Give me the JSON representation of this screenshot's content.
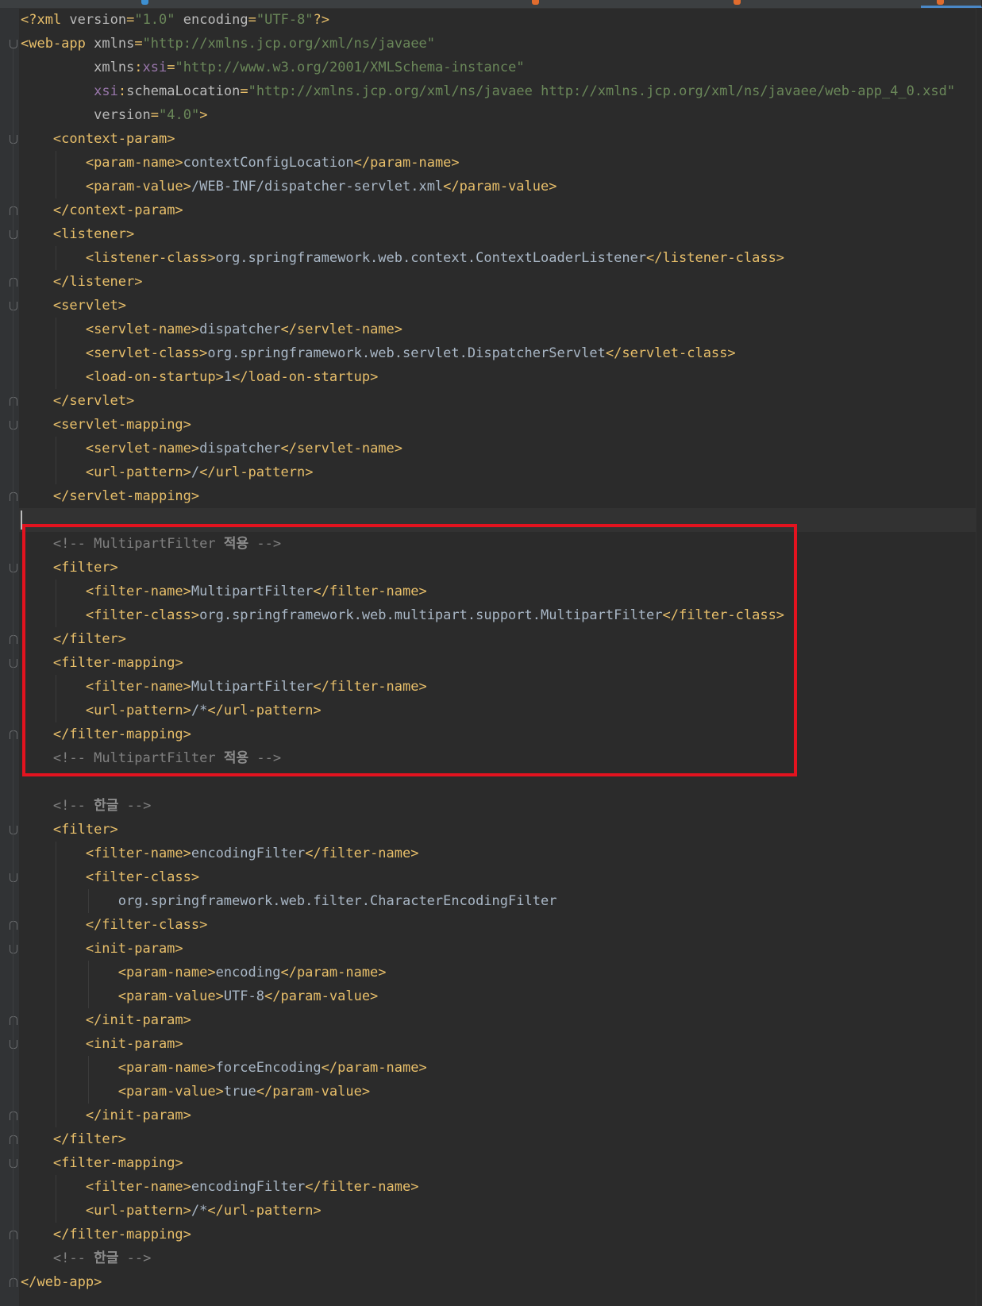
{
  "editor": {
    "language": "xml",
    "colors": {
      "background": "#2b2b2b",
      "tag": "#e8bf6a",
      "attribute": "#bababa",
      "value": "#6a8759",
      "namespace": "#9876aa",
      "text": "#a9b7c6",
      "comment": "#808080",
      "highlight_box": "#e3131f"
    },
    "lines": [
      {
        "indent": 0,
        "tokens": [
          [
            "tg",
            "<?xml "
          ],
          [
            "at",
            "version"
          ],
          [
            "tg",
            "="
          ],
          [
            "vl",
            "\"1.0\""
          ],
          [
            "at",
            " encoding"
          ],
          [
            "tg",
            "="
          ],
          [
            "vl",
            "\"UTF-8\""
          ],
          [
            "tg",
            "?>"
          ]
        ]
      },
      {
        "indent": 0,
        "tokens": [
          [
            "tg",
            "<web-app "
          ],
          [
            "at",
            "xmlns"
          ],
          [
            "tg",
            "="
          ],
          [
            "vl",
            "\"http://xmlns.jcp.org/xml/ns/javaee\""
          ]
        ]
      },
      {
        "indent": 0,
        "tokens": [
          [
            "at",
            "         xmlns"
          ],
          [
            "tg",
            ":"
          ],
          [
            "ns",
            "xsi"
          ],
          [
            "tg",
            "="
          ],
          [
            "vl",
            "\"http://www.w3.org/2001/XMLSchema-instance\""
          ]
        ]
      },
      {
        "indent": 0,
        "tokens": [
          [
            "ns",
            "         xsi"
          ],
          [
            "tg",
            ":"
          ],
          [
            "at",
            "schemaLocation"
          ],
          [
            "tg",
            "="
          ],
          [
            "vl",
            "\"http://xmlns.jcp.org/xml/ns/javaee http://xmlns.jcp.org/xml/ns/javaee/web-app_4_0.xsd\""
          ]
        ]
      },
      {
        "indent": 0,
        "tokens": [
          [
            "at",
            "         version"
          ],
          [
            "tg",
            "="
          ],
          [
            "vl",
            "\"4.0\""
          ],
          [
            "tg",
            ">"
          ]
        ]
      },
      {
        "indent": 1,
        "tokens": [
          [
            "tg",
            "<context-param>"
          ]
        ]
      },
      {
        "indent": 2,
        "tokens": [
          [
            "tg",
            "<param-name>"
          ],
          [
            "tx",
            "contextConfigLocation"
          ],
          [
            "tg",
            "</param-name>"
          ]
        ]
      },
      {
        "indent": 2,
        "tokens": [
          [
            "tg",
            "<param-value>"
          ],
          [
            "tx",
            "/WEB-INF/dispatcher-servlet.xml"
          ],
          [
            "tg",
            "</param-value>"
          ]
        ]
      },
      {
        "indent": 1,
        "tokens": [
          [
            "tg",
            "</context-param>"
          ]
        ]
      },
      {
        "indent": 1,
        "tokens": [
          [
            "tg",
            "<listener>"
          ]
        ]
      },
      {
        "indent": 2,
        "tokens": [
          [
            "tg",
            "<listener-class>"
          ],
          [
            "tx",
            "org.springframework.web.context.ContextLoaderListener"
          ],
          [
            "tg",
            "</listener-class>"
          ]
        ]
      },
      {
        "indent": 1,
        "tokens": [
          [
            "tg",
            "</listener>"
          ]
        ]
      },
      {
        "indent": 1,
        "tokens": [
          [
            "tg",
            "<servlet>"
          ]
        ]
      },
      {
        "indent": 2,
        "tokens": [
          [
            "tg",
            "<servlet-name>"
          ],
          [
            "tx",
            "dispatcher"
          ],
          [
            "tg",
            "</servlet-name>"
          ]
        ]
      },
      {
        "indent": 2,
        "tokens": [
          [
            "tg",
            "<servlet-class>"
          ],
          [
            "tx",
            "org.springframework.web.servlet.DispatcherServlet"
          ],
          [
            "tg",
            "</servlet-class>"
          ]
        ]
      },
      {
        "indent": 2,
        "tokens": [
          [
            "tg",
            "<load-on-startup>"
          ],
          [
            "tx",
            "1"
          ],
          [
            "tg",
            "</load-on-startup>"
          ]
        ]
      },
      {
        "indent": 1,
        "tokens": [
          [
            "tg",
            "</servlet>"
          ]
        ]
      },
      {
        "indent": 1,
        "tokens": [
          [
            "tg",
            "<servlet-mapping>"
          ]
        ]
      },
      {
        "indent": 2,
        "tokens": [
          [
            "tg",
            "<servlet-name>"
          ],
          [
            "tx",
            "dispatcher"
          ],
          [
            "tg",
            "</servlet-name>"
          ]
        ]
      },
      {
        "indent": 2,
        "tokens": [
          [
            "tg",
            "<url-pattern>"
          ],
          [
            "tx",
            "/"
          ],
          [
            "tg",
            "</url-pattern>"
          ]
        ]
      },
      {
        "indent": 1,
        "tokens": [
          [
            "tg",
            "</servlet-mapping>"
          ]
        ]
      },
      {
        "indent": 0,
        "tokens": []
      },
      {
        "indent": 1,
        "tokens": [
          [
            "cm",
            "<!-- MultipartFilter "
          ],
          [
            "kr",
            "적용"
          ],
          [
            "cm",
            " -->"
          ]
        ]
      },
      {
        "indent": 1,
        "tokens": [
          [
            "tg",
            "<filter>"
          ]
        ]
      },
      {
        "indent": 2,
        "tokens": [
          [
            "tg",
            "<filter-name>"
          ],
          [
            "tx",
            "MultipartFilter"
          ],
          [
            "tg",
            "</filter-name>"
          ]
        ]
      },
      {
        "indent": 2,
        "tokens": [
          [
            "tg",
            "<filter-class>"
          ],
          [
            "tx",
            "org.springframework.web.multipart.support.MultipartFilter"
          ],
          [
            "tg",
            "</filter-class>"
          ]
        ]
      },
      {
        "indent": 1,
        "tokens": [
          [
            "tg",
            "</filter>"
          ]
        ]
      },
      {
        "indent": 1,
        "tokens": [
          [
            "tg",
            "<filter-mapping>"
          ]
        ]
      },
      {
        "indent": 2,
        "tokens": [
          [
            "tg",
            "<filter-name>"
          ],
          [
            "tx",
            "MultipartFilter"
          ],
          [
            "tg",
            "</filter-name>"
          ]
        ]
      },
      {
        "indent": 2,
        "tokens": [
          [
            "tg",
            "<url-pattern>"
          ],
          [
            "tx",
            "/*"
          ],
          [
            "tg",
            "</url-pattern>"
          ]
        ]
      },
      {
        "indent": 1,
        "tokens": [
          [
            "tg",
            "</filter-mapping>"
          ]
        ]
      },
      {
        "indent": 1,
        "tokens": [
          [
            "cm",
            "<!-- MultipartFilter "
          ],
          [
            "kr",
            "적용"
          ],
          [
            "cm",
            " -->"
          ]
        ]
      },
      {
        "indent": 0,
        "tokens": []
      },
      {
        "indent": 1,
        "tokens": [
          [
            "cm",
            "<!-- "
          ],
          [
            "kr",
            "한글"
          ],
          [
            "cm",
            " -->"
          ]
        ]
      },
      {
        "indent": 1,
        "tokens": [
          [
            "tg",
            "<filter>"
          ]
        ]
      },
      {
        "indent": 2,
        "tokens": [
          [
            "tg",
            "<filter-name>"
          ],
          [
            "tx",
            "encodingFilter"
          ],
          [
            "tg",
            "</filter-name>"
          ]
        ]
      },
      {
        "indent": 2,
        "tokens": [
          [
            "tg",
            "<filter-class>"
          ]
        ]
      },
      {
        "indent": 3,
        "tokens": [
          [
            "tx",
            "org.springframework.web.filter.CharacterEncodingFilter"
          ]
        ]
      },
      {
        "indent": 2,
        "tokens": [
          [
            "tg",
            "</filter-class>"
          ]
        ]
      },
      {
        "indent": 2,
        "tokens": [
          [
            "tg",
            "<init-param>"
          ]
        ]
      },
      {
        "indent": 3,
        "tokens": [
          [
            "tg",
            "<param-name>"
          ],
          [
            "tx",
            "encoding"
          ],
          [
            "tg",
            "</param-name>"
          ]
        ]
      },
      {
        "indent": 3,
        "tokens": [
          [
            "tg",
            "<param-value>"
          ],
          [
            "tx",
            "UTF-8"
          ],
          [
            "tg",
            "</param-value>"
          ]
        ]
      },
      {
        "indent": 2,
        "tokens": [
          [
            "tg",
            "</init-param>"
          ]
        ]
      },
      {
        "indent": 2,
        "tokens": [
          [
            "tg",
            "<init-param>"
          ]
        ]
      },
      {
        "indent": 3,
        "tokens": [
          [
            "tg",
            "<param-name>"
          ],
          [
            "tx",
            "forceEncoding"
          ],
          [
            "tg",
            "</param-name>"
          ]
        ]
      },
      {
        "indent": 3,
        "tokens": [
          [
            "tg",
            "<param-value>"
          ],
          [
            "tx",
            "true"
          ],
          [
            "tg",
            "</param-value>"
          ]
        ]
      },
      {
        "indent": 2,
        "tokens": [
          [
            "tg",
            "</init-param>"
          ]
        ]
      },
      {
        "indent": 1,
        "tokens": [
          [
            "tg",
            "</filter>"
          ]
        ]
      },
      {
        "indent": 1,
        "tokens": [
          [
            "tg",
            "<filter-mapping>"
          ]
        ]
      },
      {
        "indent": 2,
        "tokens": [
          [
            "tg",
            "<filter-name>"
          ],
          [
            "tx",
            "encodingFilter"
          ],
          [
            "tg",
            "</filter-name>"
          ]
        ]
      },
      {
        "indent": 2,
        "tokens": [
          [
            "tg",
            "<url-pattern>"
          ],
          [
            "tx",
            "/*"
          ],
          [
            "tg",
            "</url-pattern>"
          ]
        ]
      },
      {
        "indent": 1,
        "tokens": [
          [
            "tg",
            "</filter-mapping>"
          ]
        ]
      },
      {
        "indent": 1,
        "tokens": [
          [
            "cm",
            "<!-- "
          ],
          [
            "kr",
            "한글"
          ],
          [
            "cm",
            " -->"
          ]
        ]
      },
      {
        "indent": 0,
        "tokens": [
          [
            "tg",
            "</web-app>"
          ]
        ]
      }
    ]
  }
}
